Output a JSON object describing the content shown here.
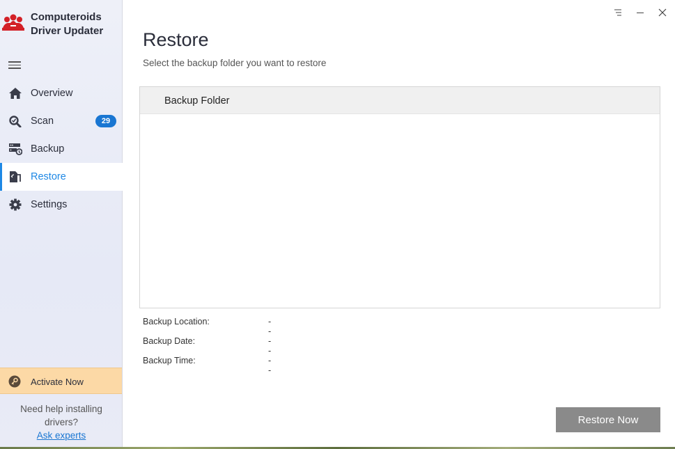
{
  "app": {
    "name_line1": "Computeroids",
    "name_line2": "Driver Updater"
  },
  "sidebar": {
    "items": [
      {
        "label": "Overview",
        "icon": "home-icon"
      },
      {
        "label": "Scan",
        "icon": "scan-icon",
        "badge": "29"
      },
      {
        "label": "Backup",
        "icon": "backup-icon"
      },
      {
        "label": "Restore",
        "icon": "restore-icon",
        "active": true
      },
      {
        "label": "Settings",
        "icon": "gear-icon"
      }
    ],
    "activate_label": "Activate Now",
    "help_text_line1": "Need help installing",
    "help_text_line2": "drivers?",
    "help_link": "Ask experts"
  },
  "main": {
    "title": "Restore",
    "subtitle": "Select the backup folder you want to restore",
    "table": {
      "column_header": "Backup Folder",
      "rows": []
    },
    "details": [
      {
        "label": "Backup Location:",
        "value": "--"
      },
      {
        "label": "Backup Date:",
        "value": "--"
      },
      {
        "label": "Backup Time:",
        "value": "--"
      }
    ],
    "restore_button": "Restore Now"
  },
  "colors": {
    "accent": "#1e88e5",
    "badge": "#1976d2",
    "activate_bg": "#fcd9a6",
    "button_disabled": "#8a8a8a",
    "logo_red": "#d32027"
  }
}
